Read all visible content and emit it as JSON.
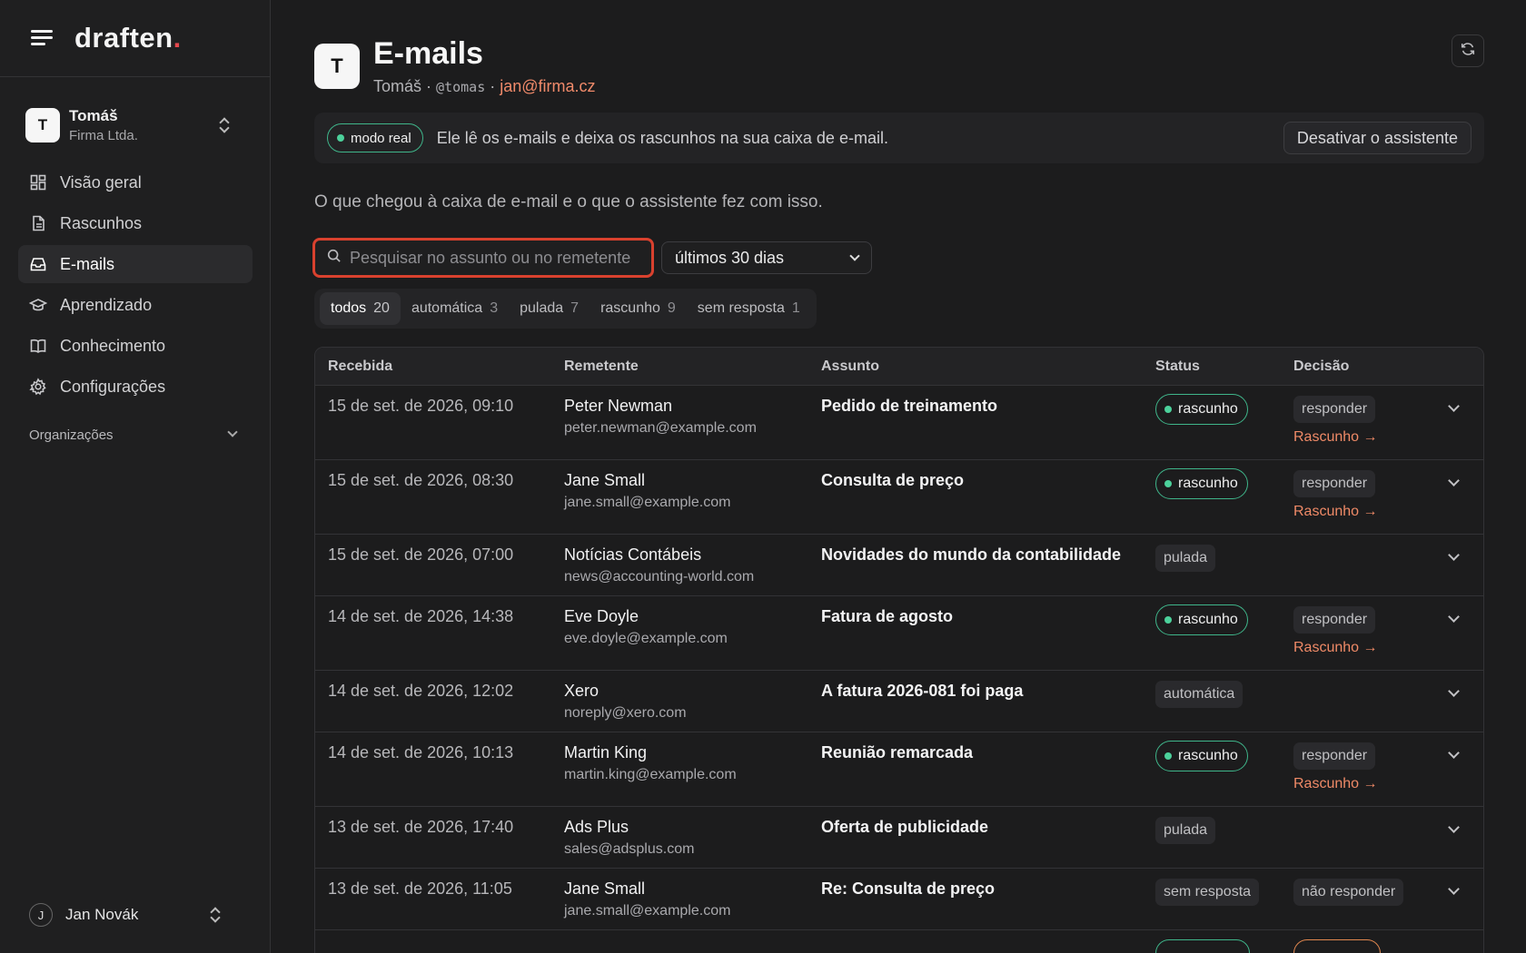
{
  "brand": {
    "logo_text": "draften",
    "logo_dot": "."
  },
  "org": {
    "initial": "T",
    "name": "Tomáš",
    "company": "Firma Ltda."
  },
  "nav": [
    {
      "icon": "grid-icon",
      "label": "Visão geral"
    },
    {
      "icon": "document-icon",
      "label": "Rascunhos"
    },
    {
      "icon": "inbox-icon",
      "label": "E-mails",
      "active": true
    },
    {
      "icon": "graduation-cap-icon",
      "label": "Aprendizado"
    },
    {
      "icon": "book-icon",
      "label": "Conhecimento"
    },
    {
      "icon": "gear-icon",
      "label": "Configurações"
    }
  ],
  "organizations_label": "Organizações",
  "user": {
    "initial": "J",
    "name": "Jan Novák"
  },
  "header": {
    "initial": "T",
    "title": "E-mails",
    "name": "Tomáš",
    "sep": "·",
    "handle": "@tomas",
    "email": "jan@firma.cz"
  },
  "banner": {
    "pill": "modo real",
    "text": "Ele lê os e-mails e deixa os rascunhos na sua caixa de e-mail.",
    "button": "Desativar o assistente"
  },
  "intro": "O que chegou à caixa de e-mail e o que o assistente fez com isso.",
  "search": {
    "placeholder": "Pesquisar no assunto ou no remetente",
    "value": ""
  },
  "period": {
    "selected": "últimos 30 dias"
  },
  "filters": [
    {
      "label": "todos",
      "count": "20",
      "active": true
    },
    {
      "label": "automática",
      "count": "3"
    },
    {
      "label": "pulada",
      "count": "7"
    },
    {
      "label": "rascunho",
      "count": "9"
    },
    {
      "label": "sem resposta",
      "count": "1"
    }
  ],
  "table": {
    "headers": {
      "received": "Recebida",
      "sender": "Remetente",
      "subject": "Assunto",
      "status": "Status",
      "decision": "Decisão"
    },
    "rows": [
      {
        "date": "15 de set. de 2026, 09:10",
        "name": "Peter Newman",
        "email": "peter.newman@example.com",
        "subject": "Pedido de treinamento",
        "status": "rascunho",
        "status_style": "green",
        "decision": "responder",
        "link": "Rascunho →"
      },
      {
        "date": "15 de set. de 2026, 08:30",
        "name": "Jane Small",
        "email": "jane.small@example.com",
        "subject": "Consulta de preço",
        "status": "rascunho",
        "status_style": "green",
        "decision": "responder",
        "link": "Rascunho →"
      },
      {
        "date": "15 de set. de 2026, 07:00",
        "name": "Notícias Contábeis",
        "email": "news@accounting-world.com",
        "subject": "Novidades do mundo da contabilidade",
        "status": "pulada",
        "status_style": "gray",
        "decision": "",
        "link": ""
      },
      {
        "date": "14 de set. de 2026, 14:38",
        "name": "Eve Doyle",
        "email": "eve.doyle@example.com",
        "subject": "Fatura de agosto",
        "status": "rascunho",
        "status_style": "green",
        "decision": "responder",
        "link": "Rascunho →"
      },
      {
        "date": "14 de set. de 2026, 12:02",
        "name": "Xero",
        "email": "noreply@xero.com",
        "subject": "A fatura 2026-081 foi paga",
        "status": "automática",
        "status_style": "gray",
        "decision": "",
        "link": ""
      },
      {
        "date": "14 de set. de 2026, 10:13",
        "name": "Martin King",
        "email": "martin.king@example.com",
        "subject": "Reunião remarcada",
        "status": "rascunho",
        "status_style": "green",
        "decision": "responder",
        "link": "Rascunho →"
      },
      {
        "date": "13 de set. de 2026, 17:40",
        "name": "Ads Plus",
        "email": "sales@adsplus.com",
        "subject": "Oferta de publicidade",
        "status": "pulada",
        "status_style": "gray",
        "decision": "",
        "link": ""
      },
      {
        "date": "13 de set. de 2026, 11:05",
        "name": "Jane Small",
        "email": "jane.small@example.com",
        "subject": "Re: Consulta de preço",
        "status": "sem resposta",
        "status_style": "gray",
        "decision": "não responder",
        "link": ""
      }
    ]
  },
  "colors": {
    "accent": "#f08a6a",
    "live_green": "#4cd19b",
    "search_border": "#d9412e"
  }
}
